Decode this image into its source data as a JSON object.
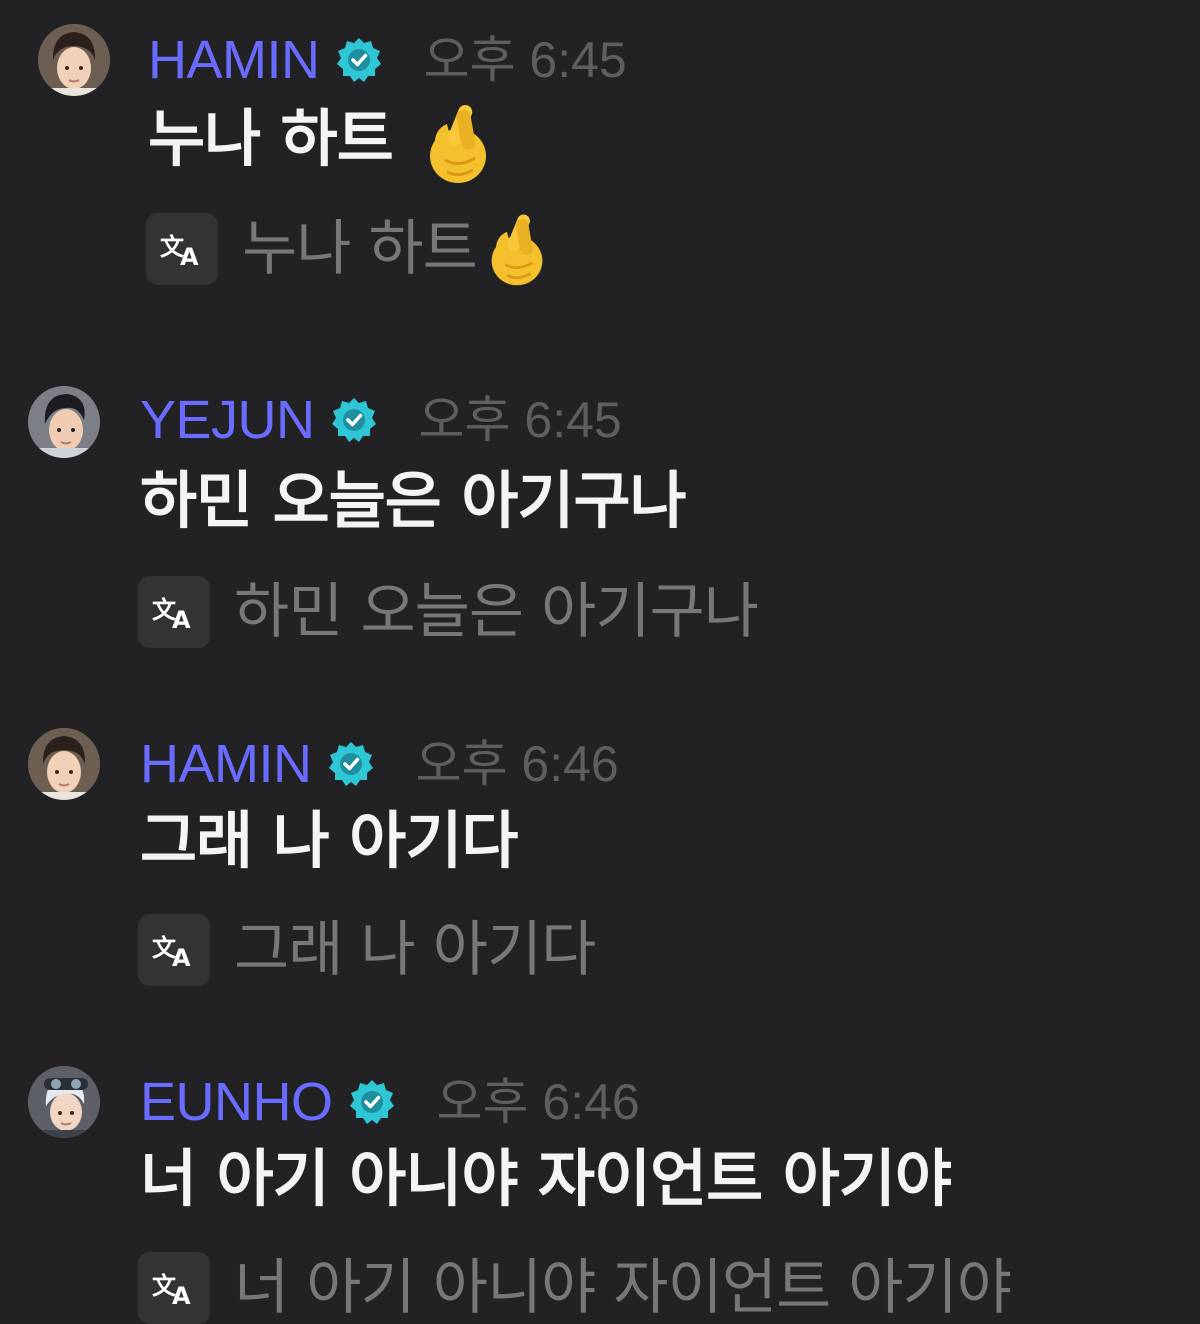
{
  "messages": [
    {
      "sender": "HAMIN",
      "time": "오후 6:45",
      "text": "누나 하트",
      "emoji": "finger-heart",
      "translation": "누나 하트",
      "verified": true
    },
    {
      "sender": "YEJUN",
      "time": "오후 6:45",
      "text": "하민 오늘은 아기구나",
      "translation": "하민 오늘은 아기구나",
      "verified": true
    },
    {
      "sender": "HAMIN",
      "time": "오후 6:46",
      "text": "그래 나 아기다",
      "translation": "그래 나 아기다",
      "verified": true
    },
    {
      "sender": "EUNHO",
      "time": "오후 6:46",
      "text": "너 아기 아니야 자이언트 아기야",
      "translation": "너 아기 아니야 자이언트 아기야",
      "verified": true
    }
  ],
  "colors": {
    "background": "#222224",
    "sender": "#6a6cff",
    "badge": "#2fc6d6",
    "time": "#5e5e62",
    "message": "#f4f4f4",
    "translation": "#77777b"
  }
}
